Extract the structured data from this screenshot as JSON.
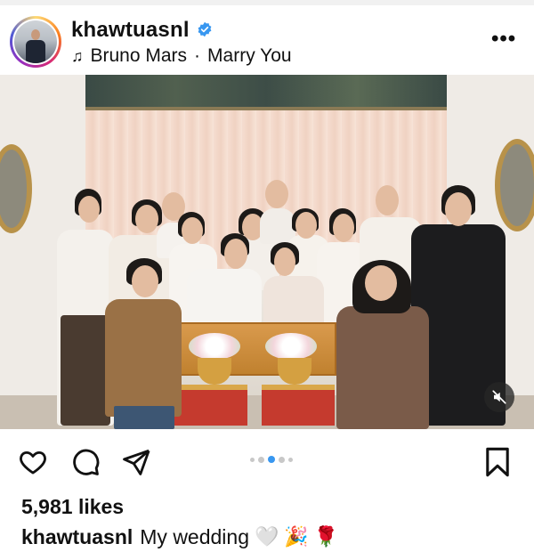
{
  "post": {
    "username": "khawtuasnl",
    "verified": true,
    "music": {
      "artist": "Bruno Mars",
      "separator": "·",
      "track": "Marry You"
    },
    "more_glyph": "•••",
    "media": {
      "carousel_count": 5,
      "carousel_active_index": 2,
      "audio_state": "muted"
    },
    "likes_text": "5,981 likes",
    "caption": {
      "username": "khawtuasnl",
      "text": "My wedding",
      "emojis": [
        "🤍",
        "🎉",
        "🌹"
      ]
    }
  },
  "icons": {
    "verified": "verified-badge-icon",
    "music": "music-note-icon",
    "more": "more-options-icon",
    "mute": "speaker-muted-icon",
    "like": "heart-icon",
    "comment": "comment-bubble-icon",
    "share": "paper-plane-icon",
    "save": "bookmark-icon"
  },
  "colors": {
    "verified": "#3897f0",
    "carousel_active": "#3897f0",
    "carousel_inactive": "#c8c8c8",
    "text": "#111111"
  }
}
